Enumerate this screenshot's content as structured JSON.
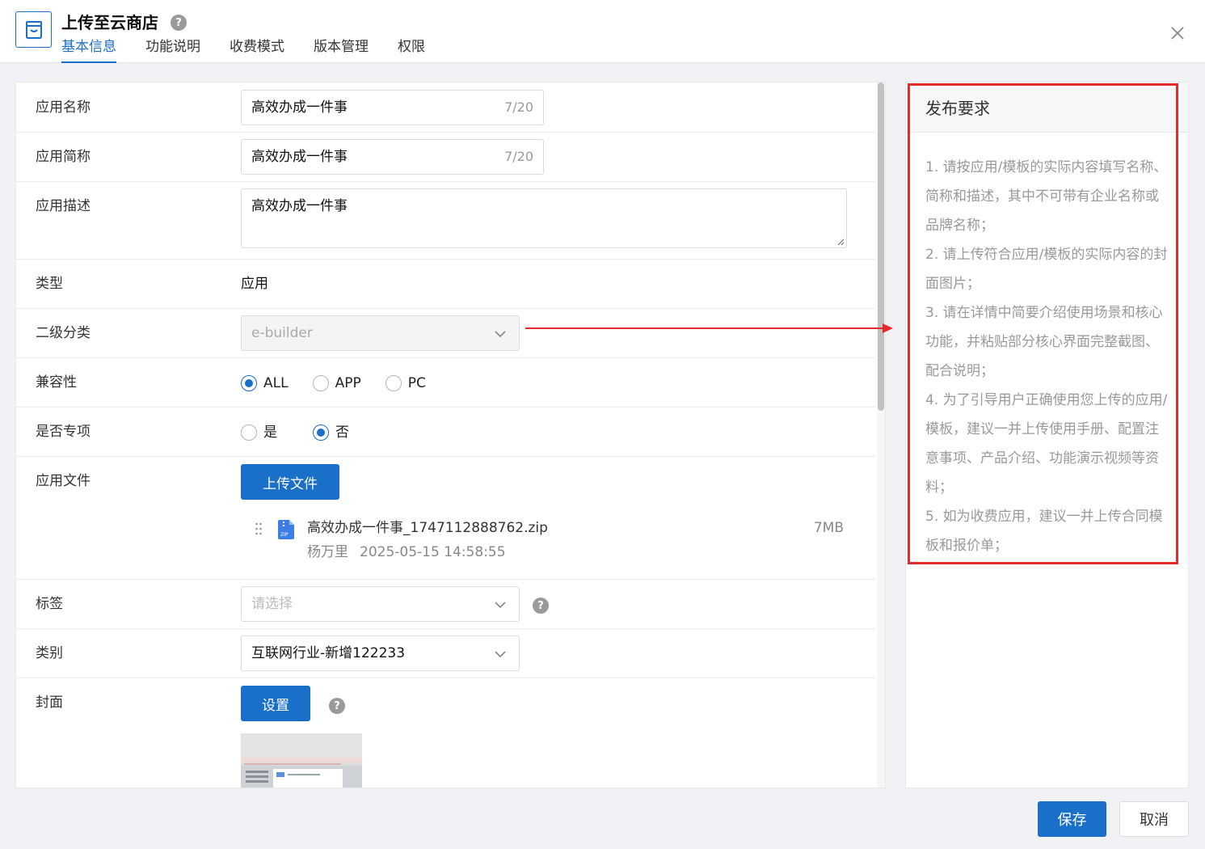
{
  "header": {
    "title": "上传至云商店",
    "tabs": [
      {
        "label": "基本信息",
        "active": true
      },
      {
        "label": "功能说明",
        "active": false
      },
      {
        "label": "收费模式",
        "active": false
      },
      {
        "label": "版本管理",
        "active": false
      },
      {
        "label": "权限",
        "active": false
      }
    ]
  },
  "form": {
    "app_name": {
      "label": "应用名称",
      "value": "高效办成一件事",
      "count": "7/20"
    },
    "app_short_name": {
      "label": "应用简称",
      "value": "高效办成一件事",
      "count": "7/20"
    },
    "app_desc": {
      "label": "应用描述",
      "value": "高效办成一件事"
    },
    "type": {
      "label": "类型",
      "value": "应用"
    },
    "sub_category": {
      "label": "二级分类",
      "value": "e-builder",
      "disabled": true
    },
    "compatibility": {
      "label": "兼容性",
      "options": [
        "ALL",
        "APP",
        "PC"
      ],
      "selected": "ALL"
    },
    "special": {
      "label": "是否专项",
      "options": [
        "是",
        "否"
      ],
      "selected": "否"
    },
    "app_file": {
      "label": "应用文件",
      "upload_label": "上传文件",
      "file": {
        "name": "高效办成一件事_1747112888762.zip",
        "uploader": "杨万里",
        "time": "2025-05-15 14:58:55",
        "size": "7MB",
        "icon": "zip-file-icon"
      }
    },
    "tags": {
      "label": "标签",
      "placeholder": "请选择"
    },
    "category": {
      "label": "类别",
      "value": "互联网行业-新增122233"
    },
    "cover": {
      "label": "封面",
      "button_label": "设置"
    }
  },
  "side": {
    "title": "发布要求",
    "items": [
      "1. 请按应用/模板的实际内容填写名称、简称和描述，其中不可带有企业名称或品牌名称；",
      "2. 请上传符合应用/模板的实际内容的封面图片；",
      "3. 请在详情中简要介绍使用场景和核心功能，并粘贴部分核心界面完整截图、配合说明；",
      "4. 为了引导用户正确使用您上传的应用/模板，建议一并上传使用手册、配置注意事项、产品介绍、功能演示视频等资料；",
      "5. 如为收费应用，建议一并上传合同模板和报价单；"
    ]
  },
  "footer": {
    "save_label": "保存",
    "cancel_label": "取消"
  },
  "colors": {
    "primary": "#1a6fc9",
    "highlight": "#e32b2b"
  }
}
